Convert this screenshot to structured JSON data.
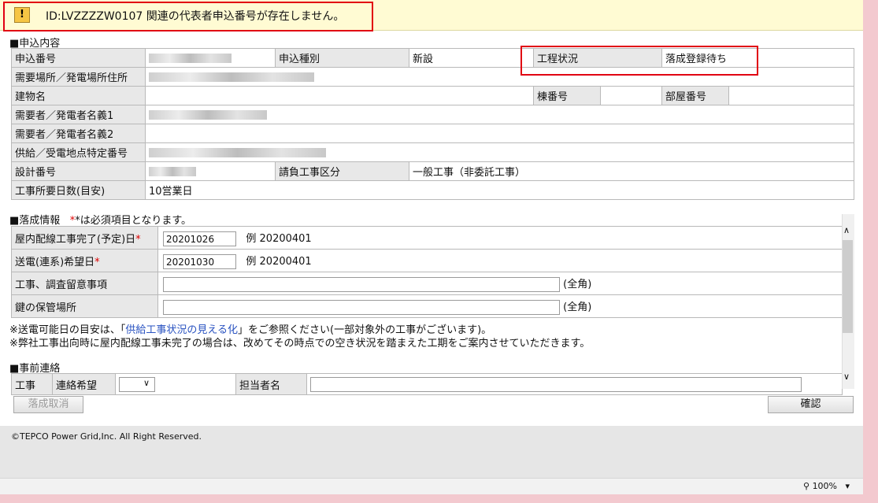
{
  "message": {
    "text": "ID:LVZZZZW0107 関連の代表者申込番号が存在しません。",
    "icon": "warning-icon"
  },
  "application": {
    "section_title": "■申込内容",
    "app_no_label": "申込番号",
    "app_type_label": "申込種別",
    "app_type_value": "新設",
    "process_label": "工程状況",
    "process_value": "落成登録待ち",
    "address_label": "需要場所／発電場所住所",
    "building_label": "建物名",
    "bldg_no_label": "棟番号",
    "room_no_label": "部屋番号",
    "holder1_label": "需要者／発電者名義1",
    "holder2_label": "需要者／発電者名義2",
    "supply_point_label": "供給／受電地点特定番号",
    "design_no_label": "設計番号",
    "contract_type_label": "請負工事区分",
    "contract_type_value": "一般工事（非委託工事）",
    "days_label": "工事所要日数(目安)",
    "days_value": "10営業日"
  },
  "completion": {
    "section_title": "■落成情報",
    "required_note": "*は必須項目となります。",
    "indoor_label": "屋内配線工事完了(予定)日",
    "indoor_value": "20201026",
    "indoor_example": "例 20200401",
    "power_label": "送電(連系)希望日",
    "power_value": "20201030",
    "power_example": "例 20200401",
    "notes_label": "工事、調査留意事項",
    "notes_suffix": "(全角)",
    "key_label": "鍵の保管場所",
    "key_suffix": "(全角)",
    "required_mark": "*",
    "info1_pre": "※送電可能日の目安は、「",
    "info1_link": "供給工事状況の見える化",
    "info1_post": "」をご参照ください(一部対象外の工事がございます)。",
    "info2": "※弊社工事出向時に屋内配線工事未完了の場合は、改めてその時点での空き状況を踏まえた工期をご案内させていただきます。"
  },
  "prior": {
    "section_title": "■事前連絡",
    "work_label": "工事",
    "contact_label": "連絡希望",
    "contact_value": "",
    "person_label": "担当者名"
  },
  "buttons": {
    "cancel": "落成取消",
    "confirm": "確認"
  },
  "footer": {
    "copyright": "©TEPCO Power Grid,Inc. All Right Reserved."
  },
  "status": {
    "zoom": "100%"
  },
  "colors": {
    "highlight": "#e10012",
    "message_bg": "#fffbd3",
    "label_bg": "#e8e8e8",
    "link": "#2a53c1"
  }
}
